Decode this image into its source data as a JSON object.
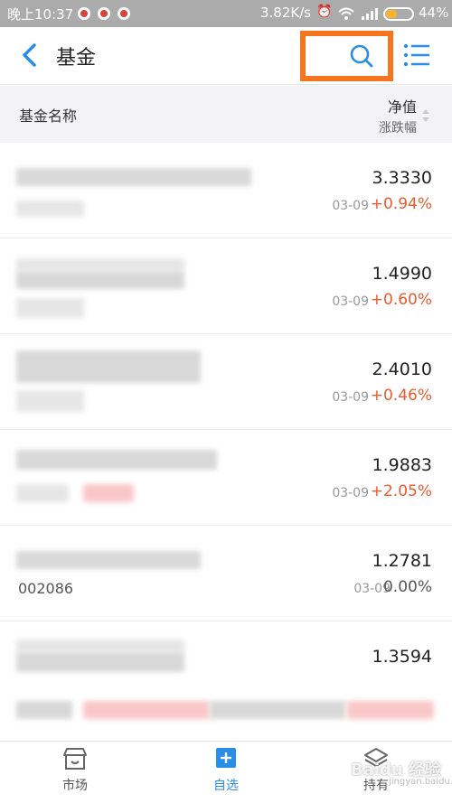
{
  "status_bar": {
    "time": "晚上10:37",
    "speed": "3.82K/s",
    "battery_text": "44%",
    "battery_level": 0.44
  },
  "header": {
    "title": "基金",
    "accent": "#2b8ee6",
    "highlight_color": "#f7751e"
  },
  "columns": {
    "name": "基金名称",
    "nav": "净值",
    "change": "涨跌幅"
  },
  "funds": [
    {
      "nav": "3.3330",
      "date": "03-09",
      "change": "+0.94%"
    },
    {
      "nav": "1.4990",
      "date": "03-09",
      "change": "+0.60%"
    },
    {
      "nav": "2.4010",
      "date": "03-09",
      "change": "+0.46%"
    },
    {
      "nav": "1.9883",
      "date": "03-09",
      "change": "+2.05%"
    },
    {
      "nav": "1.2781",
      "date": "03-09",
      "change": "0.00%",
      "code": "002086"
    },
    {
      "nav": "1.3594",
      "date": "",
      "change": ""
    }
  ],
  "tabs": [
    {
      "label": "市场",
      "icon": "store-icon"
    },
    {
      "label": "自选",
      "icon": "plus-square-icon",
      "active": true
    },
    {
      "label": "持有",
      "icon": "layers-icon"
    }
  ],
  "watermark": {
    "logo": "Baidu 经验",
    "sub": "jingyan.baidu.com"
  }
}
